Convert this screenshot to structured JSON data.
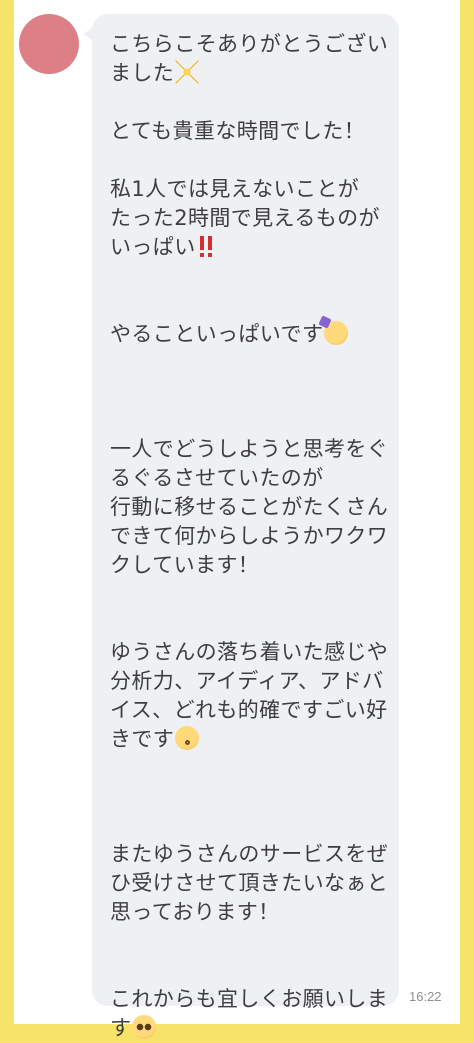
{
  "chat": {
    "message": {
      "lines": [
        "こちらこそありがとうござい",
        "ました",
        "とても貴重な時間でした！",
        "私1人では見えないことが",
        "たった2時間で見えるものが",
        "いっぱい",
        "やることいっぱいです",
        "一人でどうしようと思考をぐ",
        "るぐるさせていたのが",
        "行動に移せることがたくさん",
        "できて何からしようかワクワ",
        "クしています！",
        "ゆうさんの落ち着いた感じや",
        "分析力、アイディア、アドバ",
        "イス、どれも的確ですごい好",
        "きです",
        "またゆうさんのサービスをぜ",
        "ひ受けさせて頂きたいなぁと",
        "思っております！",
        "これからも宜しくお願いしま",
        "す"
      ],
      "emojis": {
        "sparkles": "sparkles-icon",
        "double_exclamation": "double-exclamation-icon",
        "partying_face": "partying-face-icon",
        "kissing_face": "kissing-face-icon",
        "pleading_face": "pleading-face-icon"
      },
      "timestamp": "16:22"
    },
    "colors": {
      "frame": "#f6e36a",
      "avatar": "#dd7f86",
      "bubble": "#eef0f4",
      "text": "#3e3e3e",
      "timestamp": "#8f8f8f"
    }
  }
}
